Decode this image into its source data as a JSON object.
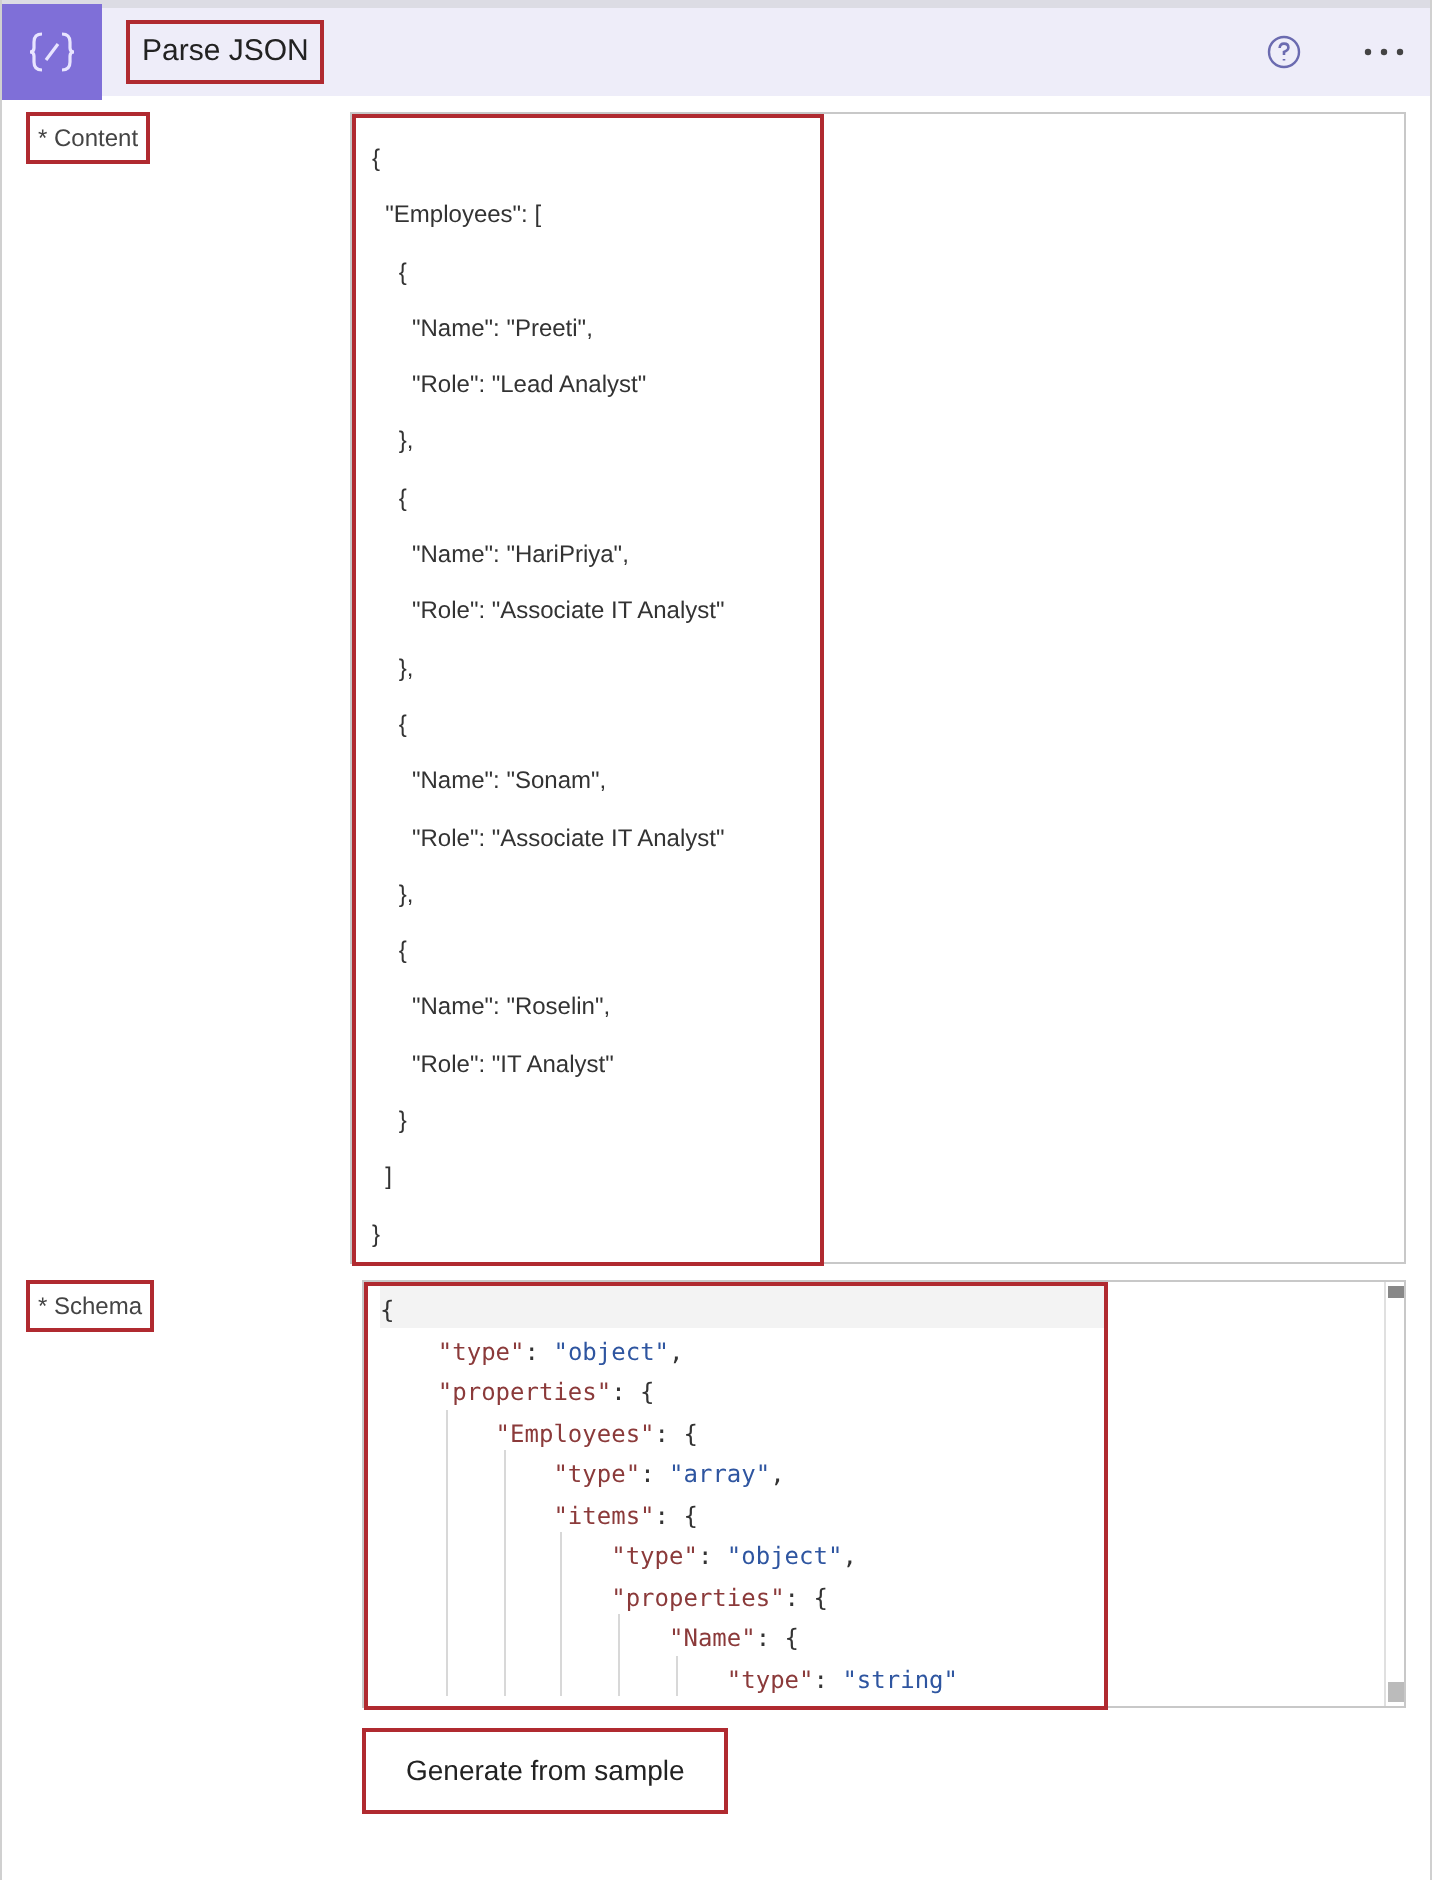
{
  "header": {
    "title": "Parse JSON"
  },
  "fields": [
    {
      "label": "* Content",
      "kind": "text",
      "lines": [
        "{",
        "  \"Employees\": [",
        "    {",
        "      \"Name\": \"Preeti\",",
        "      \"Role\": \"Lead Analyst\"",
        "    },",
        "    {",
        "      \"Name\": \"HariPriya\",",
        "      \"Role\": \"Associate IT Analyst\"",
        "    },",
        "    {",
        "      \"Name\": \"Sonam\",",
        "      \"Role\": \"Associate IT Analyst\"",
        "    },",
        "    {",
        "      \"Name\": \"Roselin\",",
        "      \"Role\": \"IT Analyst\"",
        "    }",
        "  ]",
        "}"
      ]
    },
    {
      "label": "* Schema",
      "kind": "code",
      "lines": [
        "{",
        "    \"type\": \"object\",",
        "    \"properties\": {",
        "        \"Employees\": {",
        "            \"type\": \"array\",",
        "            \"items\": {",
        "                \"type\": \"object\",",
        "                \"properties\": {",
        "                    \"Name\": {",
        "                        \"type\": \"string\""
      ]
    }
  ],
  "button": "Generate from sample"
}
